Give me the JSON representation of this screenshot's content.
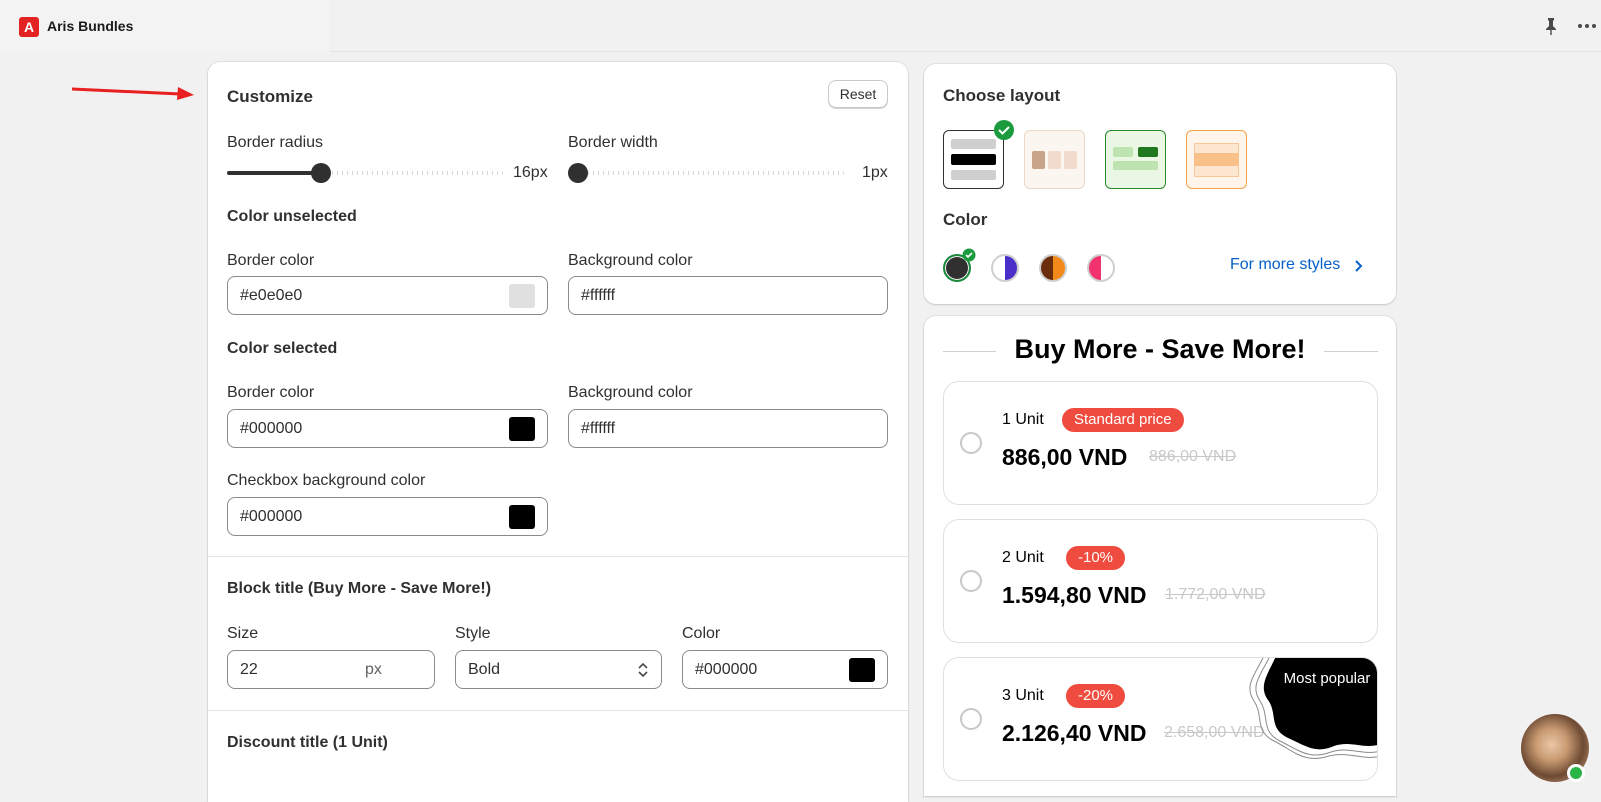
{
  "app": {
    "title": "Aris Bundles",
    "logo_letter": "A"
  },
  "customize": {
    "title": "Customize",
    "reset_label": "Reset",
    "border_radius": {
      "label": "Border radius",
      "value": "16px",
      "level": 0.33
    },
    "border_width": {
      "label": "Border width",
      "value": "1px",
      "level": 0.0
    },
    "unselected": {
      "title": "Color unselected",
      "border_label": "Border color",
      "border_value": "#e0e0e0",
      "border_swatch": "#e0e0e0",
      "bg_label": "Background color",
      "bg_value": "#ffffff",
      "bg_swatch": "#ffffff"
    },
    "selected": {
      "title": "Color selected",
      "border_label": "Border color",
      "border_value": "#000000",
      "border_swatch": "#000000",
      "bg_label": "Background color",
      "bg_value": "#ffffff",
      "bg_swatch": "#ffffff",
      "checkbox_label": "Checkbox background color",
      "checkbox_value": "#000000",
      "checkbox_swatch": "#000000"
    },
    "block_title": {
      "title": "Block title (Buy More - Save More!)",
      "size_label": "Size",
      "size_value": "22",
      "size_unit": "px",
      "style_label": "Style",
      "style_value": "Bold",
      "color_label": "Color",
      "color_value": "#000000",
      "color_swatch": "#000000"
    },
    "discount_title": {
      "title": "Discount title (1 Unit)"
    }
  },
  "layout_panel": {
    "title": "Choose layout",
    "color_title": "Color",
    "more_styles": "For more styles",
    "color_options": [
      {
        "left": "#303030",
        "right": "#303030",
        "ring": "#1c8a3e",
        "selected": true
      },
      {
        "left": "#ffffff",
        "right": "#4b2fc9",
        "ring": "#cfcfcf",
        "selected": false
      },
      {
        "left": "#6a2e0d",
        "right": "#f28a1a",
        "ring": "#cfcfcf",
        "selected": false
      },
      {
        "left": "#f2316f",
        "right": "#ffffff",
        "ring": "#cfcfcf",
        "selected": false
      }
    ]
  },
  "preview": {
    "title": "Buy More - Save More!",
    "offers": [
      {
        "unit": "1 Unit",
        "badge": "Standard price",
        "price": "886,00 VND",
        "old_price": "886,00 VND"
      },
      {
        "unit": "2 Unit",
        "badge": "-10%",
        "price": "1.594,80 VND",
        "old_price": "1.772,00 VND"
      },
      {
        "unit": "3 Unit",
        "badge": "-20%",
        "price": "2.126,40 VND",
        "old_price": "2.658,00 VND",
        "ribbon": "Most popular"
      }
    ]
  },
  "colors": {
    "accent_red": "#ef4c3f",
    "link": "#0660c9",
    "check_green": "#1c9b3e"
  }
}
